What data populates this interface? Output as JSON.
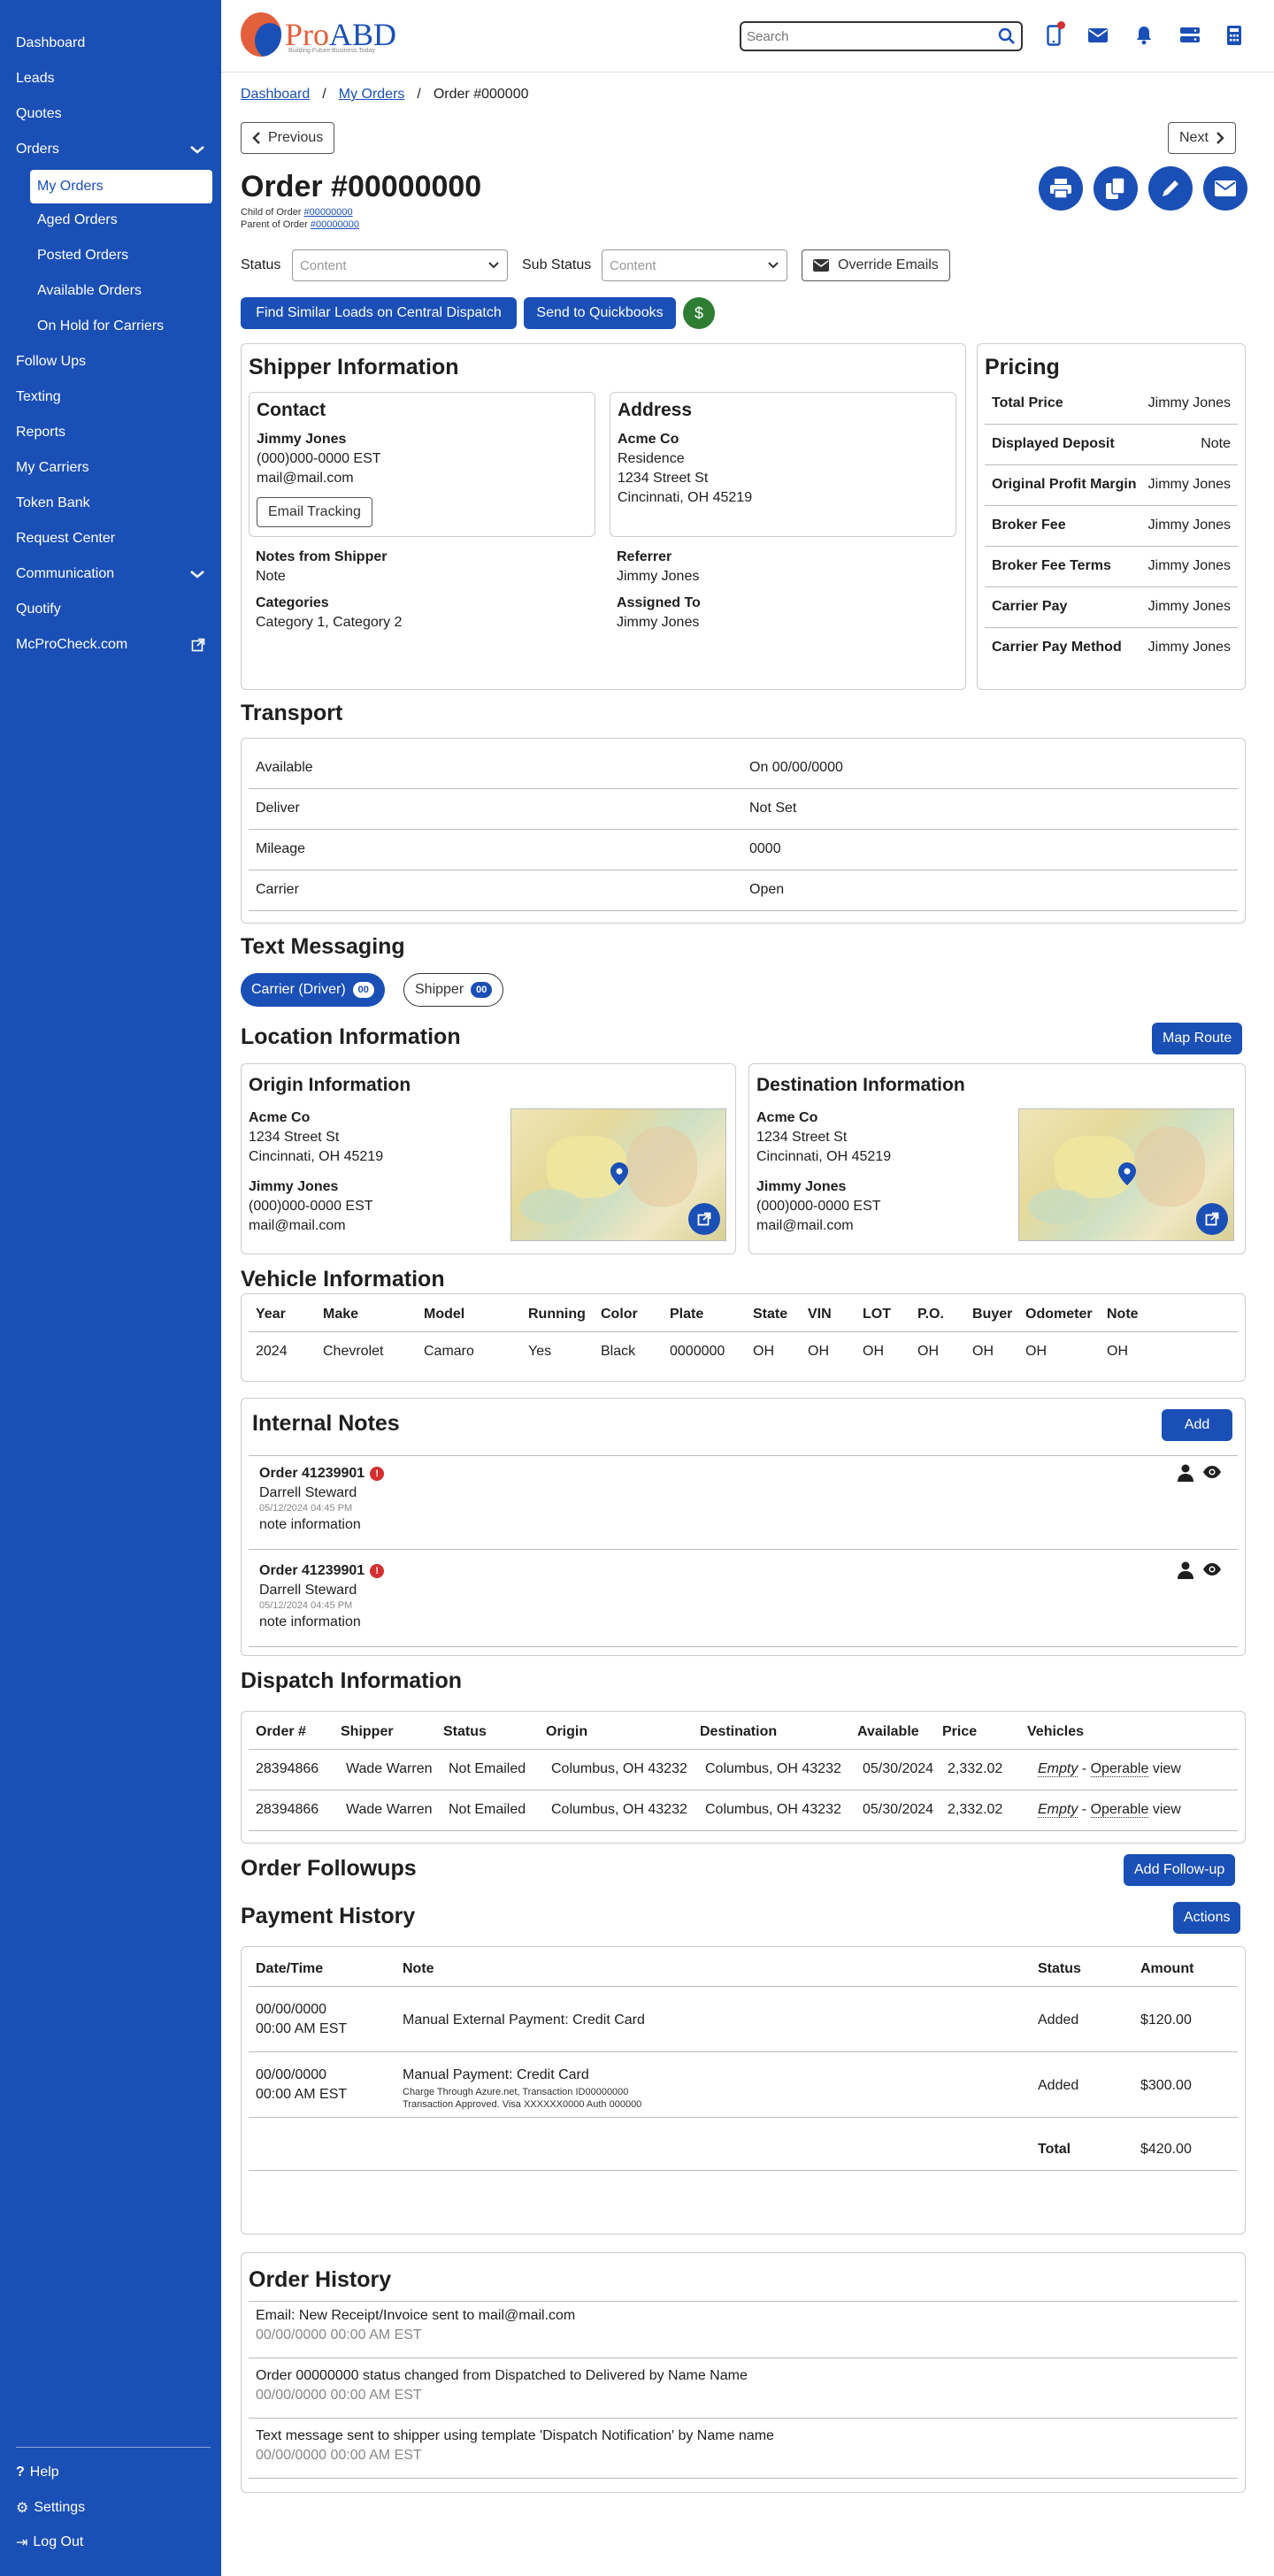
{
  "sidebar": {
    "items": [
      "Dashboard",
      "Leads",
      "Quotes",
      "Orders"
    ],
    "orders_sub": [
      "My Orders",
      "Aged Orders",
      "Posted Orders",
      "Available Orders",
      "On Hold for Carriers"
    ],
    "items2": [
      "Follow Ups",
      "Texting",
      "Reports",
      "My Carriers",
      "Token Bank",
      "Request Center",
      "Communication",
      "Quotify",
      "McProCheck.com"
    ],
    "bottom": [
      "Help",
      "Settings",
      "Log Out"
    ]
  },
  "header": {
    "logo_pro": "Pro",
    "logo_abd": "ABD",
    "logo_tag": "Building Future Business Today",
    "search_placeholder": "Search"
  },
  "breadcrumb": [
    "Dashboard",
    "My Orders",
    "Order #000000"
  ],
  "nav": {
    "previous": "Previous",
    "next": "Next"
  },
  "order": {
    "title": "Order #00000000",
    "child_label": "Child of Order",
    "child_link": "#00000000",
    "parent_label": "Parent of Order",
    "parent_link": "#00000000"
  },
  "filters": {
    "status_label": "Status",
    "status_value": "Content",
    "substatus_label": "Sub Status",
    "substatus_value": "Content",
    "override_emails": "Override Emails"
  },
  "actions": {
    "find_similar": "Find Similar Loads on Central Dispatch",
    "send_qb": "Send to Quickbooks",
    "dollar": "$"
  },
  "shipper": {
    "title": "Shipper Information",
    "contact_title": "Contact",
    "contact_name": "Jimmy Jones",
    "contact_phone": "(000)000-0000 EST",
    "contact_email": "mail@mail.com",
    "email_tracking": "Email Tracking",
    "address_title": "Address",
    "address_company": "Acme Co",
    "address_type": "Residence",
    "address_street": "1234 Street St",
    "address_city": "Cincinnati, OH 45219",
    "notes_label": "Notes from Shipper",
    "notes_value": "Note",
    "referrer_label": "Referrer",
    "referrer_value": "Jimmy Jones",
    "categories_label": "Categories",
    "categories_value": "Category 1, Category 2",
    "assigned_label": "Assigned To",
    "assigned_value": "Jimmy Jones"
  },
  "pricing": {
    "title": "Pricing",
    "rows": [
      {
        "label": "Total Price",
        "value": "Jimmy Jones"
      },
      {
        "label": "Displayed Deposit",
        "value": "Note"
      },
      {
        "label": "Original Profit Margin",
        "value": "Jimmy Jones"
      },
      {
        "label": "Broker Fee",
        "value": "Jimmy Jones"
      },
      {
        "label": "Broker Fee Terms",
        "value": "Jimmy Jones"
      },
      {
        "label": "Carrier Pay",
        "value": "Jimmy Jones"
      },
      {
        "label": "Carrier Pay Method",
        "value": "Jimmy Jones"
      }
    ]
  },
  "transport": {
    "title": "Transport",
    "rows": [
      {
        "label": "Available",
        "value": "On 00/00/0000"
      },
      {
        "label": "Deliver",
        "value": "Not Set"
      },
      {
        "label": "Mileage",
        "value": "0000"
      },
      {
        "label": "Carrier",
        "value": "Open"
      }
    ]
  },
  "texting": {
    "title": "Text Messaging",
    "carrier": "Carrier (Driver)",
    "carrier_count": "00",
    "shipper": "Shipper",
    "shipper_count": "00"
  },
  "location": {
    "title": "Location Information",
    "map_route": "Map Route",
    "origin": {
      "title": "Origin Information",
      "company": "Acme Co",
      "street": "1234 Street St",
      "city": "Cincinnati, OH 45219",
      "name": "Jimmy Jones",
      "phone": "(000)000-0000 EST",
      "email": "mail@mail.com"
    },
    "destination": {
      "title": "Destination Information",
      "company": "Acme Co",
      "street": "1234 Street St",
      "city": "Cincinnati, OH 45219",
      "name": "Jimmy Jones",
      "phone": "(000)000-0000 EST",
      "email": "mail@mail.com"
    }
  },
  "vehicle": {
    "title": "Vehicle Information",
    "headers": [
      "Year",
      "Make",
      "Model",
      "Running",
      "Color",
      "Plate",
      "State",
      "VIN",
      "LOT",
      "P.O.",
      "Buyer",
      "Odometer",
      "Note"
    ],
    "row": [
      "2024",
      "Chevrolet",
      "Camaro",
      "Yes",
      "Black",
      "0000000",
      "OH",
      "OH",
      "OH",
      "OH",
      "OH",
      "OH",
      "OH"
    ]
  },
  "notes": {
    "title": "Internal Notes",
    "add": "Add",
    "items": [
      {
        "order": "Order 41239901",
        "alert": "!",
        "author": "Darrell Steward",
        "date": "05/12/2024 04:45 PM",
        "text": "note information"
      },
      {
        "order": "Order 41239901",
        "alert": "!",
        "author": "Darrell Steward",
        "date": "05/12/2024 04:45 PM",
        "text": "note information"
      }
    ]
  },
  "dispatch": {
    "title": "Dispatch Information",
    "headers": [
      "Order #",
      "Shipper",
      "Status",
      "Origin",
      "Destination",
      "Available",
      "Price",
      "Vehicles"
    ],
    "rows": [
      {
        "order": "28394866",
        "shipper": "Wade Warren",
        "status": "Not Emailed",
        "origin": "Columbus, OH 43232",
        "destination": "Columbus, OH 43232",
        "available": "05/30/2024",
        "price": "2,332.02",
        "empty": "Empty",
        "sep": " - ",
        "operable": "Operable",
        "view": "view"
      },
      {
        "order": "28394866",
        "shipper": "Wade Warren",
        "status": "Not Emailed",
        "origin": "Columbus, OH 43232",
        "destination": "Columbus, OH 43232",
        "available": "05/30/2024",
        "price": "2,332.02",
        "empty": "Empty",
        "sep": " - ",
        "operable": "Operable",
        "view": "view"
      }
    ]
  },
  "followups": {
    "title": "Order Followups",
    "add": "Add Follow-up"
  },
  "payment": {
    "title": "Payment History",
    "actions": "Actions",
    "headers": [
      "Date/Time",
      "Note",
      "Status",
      "Amount"
    ],
    "rows": [
      {
        "date": "00/00/0000",
        "time": "00:00 AM EST",
        "note": "Manual External Payment: Credit Card",
        "detail1": "",
        "detail2": "",
        "status": "Added",
        "amount": "$120.00"
      },
      {
        "date": "00/00/0000",
        "time": "00:00 AM EST",
        "note": "Manual Payment: Credit Card",
        "detail1": "Charge Through Azure.net, Transaction ID00000000",
        "detail2": "Transaction Approved. Visa XXXXXX0000 Auth 000000",
        "status": "Added",
        "amount": "$300.00"
      }
    ],
    "total_label": "Total",
    "total_value": "$420.00"
  },
  "history": {
    "title": "Order History",
    "items": [
      {
        "text": "Email: New Receipt/Invoice sent to mail@mail.com",
        "time": "00/00/0000 00:00 AM EST"
      },
      {
        "text": "Order 00000000 status changed from Dispatched to Delivered by Name Name",
        "time": "00/00/0000 00:00 AM EST"
      },
      {
        "text": "Text message sent to shipper using template 'Dispatch Notification' by Name name",
        "time": "00/00/0000 00:00 AM EST"
      }
    ]
  },
  "colors": {
    "primary": "#1a4fb6",
    "accent": "#e2603c",
    "success": "#2e7d32",
    "danger": "#d32f2f"
  }
}
